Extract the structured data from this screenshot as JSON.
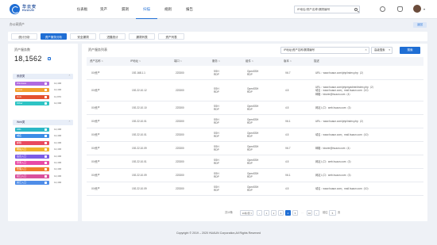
{
  "header": {
    "logo_cn": "华云安",
    "logo_en": "HUAUN",
    "nav": [
      "仪表板",
      "资产",
      "漏洞",
      "扫描",
      "规则",
      "报告"
    ],
    "active_nav": 3,
    "search_value": "IP地址/资产名称/漏洞编号"
  },
  "breadcrumb": "办公网资产",
  "back_label": "返回",
  "tabs": [
    "统计分析",
    "资产服务分析",
    "安全漏洞",
    "进展统计",
    "漏洞列表",
    "资产列表"
  ],
  "active_tab": 1,
  "left": {
    "title": "资产服务数",
    "total": "18,1562",
    "total_badge": "↗",
    "groups": [
      {
        "label": "系统类",
        "items": [
          {
            "name": "Windows",
            "value": "12,400",
            "color": "#b06be0",
            "pct": 0.56
          },
          {
            "name": "Linux",
            "value": "12,400",
            "color": "#f3a12e",
            "pct": 0.56
          },
          {
            "name": "Unix",
            "value": "11,970",
            "color": "#e4522f",
            "pct": 0.56
          },
          {
            "name": "Other",
            "value": "12,300",
            "color": "#2ec4c4",
            "pct": 0.56
          }
        ]
      },
      {
        "label": "Web类",
        "items": [
          {
            "name": "URL",
            "value": "12,400",
            "color": "#2bb7c6",
            "pct": 0.56
          },
          {
            "name": "域名",
            "value": "12,400",
            "color": "#3b8ce6",
            "pct": 0.56
          },
          {
            "name": "邮箱",
            "value": "12,400",
            "color": "#e84a5f",
            "pct": 0.56
          },
          {
            "name": "网站入口",
            "value": "12,400",
            "color": "#f0b12a",
            "pct": 0.56
          },
          {
            "name": "后台入口",
            "value": "12,400",
            "color": "#7c5ce6",
            "pct": 0.56
          },
          {
            "name": "登录入口",
            "value": "12,400",
            "color": "#e84aa7",
            "pct": 0.56
          },
          {
            "name": "管理入口",
            "value": "12,400",
            "color": "#f07d2a",
            "pct": 0.56
          },
          {
            "name": "接口入口",
            "value": "12,400",
            "color": "#d94f9c",
            "pct": 0.56
          },
          {
            "name": "其它入口",
            "value": "12,400",
            "color": "#4f8de8",
            "pct": 0.56
          }
        ]
      }
    ]
  },
  "main": {
    "title": "资产服务列表",
    "search_value": "IP地址/资产名称/漏洞编号",
    "select_value": "高级搜索",
    "search_button": "搜索",
    "columns": [
      "资产名称",
      "IP地址",
      "端口",
      "服务",
      "组件",
      "版本",
      "描述"
    ],
    "rows": [
      {
        "name": "XX资产",
        "ip": "192.168.1.1",
        "port": "223300",
        "service": [
          "SSH",
          "RDP"
        ],
        "component": [
          "OpenSSH",
          "RDP"
        ],
        "version": "V6.7",
        "desc": [
          "URL：www.huaun.com/php/index.php（2）"
        ]
      },
      {
        "name": "XX资产",
        "ip": "192.22.10.12",
        "port": "223300",
        "service": [
          "SSH",
          "RDP"
        ],
        "component": [
          "OpenSSH",
          "RDP"
        ],
        "version": "4.5",
        "desc": [
          "URL：www.huaun.com/phpmyadmin/index.php（2）",
          "域名：www.huaun.com；mail.huaun.com（10）",
          "邮箱：tdover@huaun.com（4）"
        ]
      },
      {
        "name": "XX资产",
        "ip": "192.22.10.10",
        "port": "223300",
        "service": [
          "SSH",
          "RDP"
        ],
        "component": [
          "OpenSSH",
          "RDP"
        ],
        "version": "4.5",
        "desc": [
          "网站入口：web.huaun.com（3）"
        ]
      },
      {
        "name": "XX资产",
        "ip": "192.22.10.01",
        "port": "223300",
        "service": [
          "SSH",
          "RDP"
        ],
        "component": [
          "OpenSSH",
          "RDP"
        ],
        "version": "V6.1",
        "desc": [
          "URL：www.huaun.com/php/index.php（2）"
        ]
      },
      {
        "name": "XX资产",
        "ip": "192.22.10.01",
        "port": "223300",
        "service": [
          "SSH",
          "RDP"
        ],
        "component": [
          "OpenSSH",
          "RDP"
        ],
        "version": "4.5",
        "desc": [
          "域名：www.huaun.com；mail.huaun.com（10）"
        ]
      },
      {
        "name": "XX资产",
        "ip": "192.22.10.09",
        "port": "223300",
        "service": [
          "SSH",
          "RDP"
        ],
        "component": [
          "OpenSSH",
          "RDP"
        ],
        "version": "V6.7",
        "desc": [
          "邮箱：tdover@huaun.com（4）"
        ]
      },
      {
        "name": "XX资产",
        "ip": "192.22.10.01",
        "port": "223300",
        "service": [
          "SSH",
          "RDP"
        ],
        "component": [
          "OpenSSH",
          "RDP"
        ],
        "version": "4.5",
        "desc": [
          "网站入口：web.huaun.com（3）"
        ]
      },
      {
        "name": "XX资产",
        "ip": "192.22.10.09",
        "port": "223300",
        "service": [
          "SSH",
          "RDP"
        ],
        "component": [
          "OpenSSH",
          "RDP"
        ],
        "version": "V6.1",
        "desc": [
          "网站入口：web.huaun.com（3）"
        ]
      },
      {
        "name": "XX资产",
        "ip": "192.22.10.09",
        "port": "223300",
        "service": [
          "SSH",
          "RDP"
        ],
        "component": [
          "OpenSSH",
          "RDP"
        ],
        "version": "4.5",
        "desc": [
          "域名：www.huaun.com；mail.huaun.com（10）"
        ]
      }
    ],
    "pager": {
      "total_text": "共10条",
      "page_size": "10条/页",
      "pages": [
        "1",
        "2",
        "3",
        "4",
        "5",
        "…",
        "10"
      ],
      "active_page": "4",
      "goto_label": "前往",
      "goto_value": "5",
      "page_unit": "页"
    }
  },
  "footer": "Copyright © 2019 – 2020 HUAUN Corporation,All Rights Reserved"
}
